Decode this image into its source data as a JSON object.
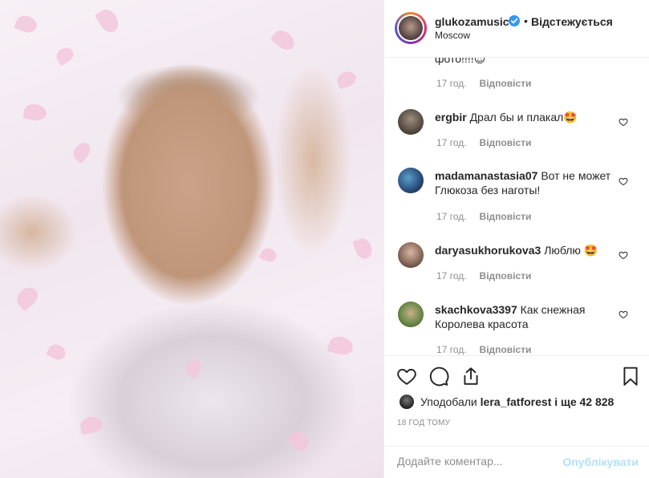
{
  "post": {
    "username": "glukozamusic",
    "follow_status": "Відстежується",
    "location": "Moscow",
    "separator": "•"
  },
  "comments": [
    {
      "username": "",
      "text": "фото!!!!😍",
      "time": "17 год.",
      "reply": "Відповісти"
    },
    {
      "username": "ergbir",
      "text": "Драл бы и плакал🤩",
      "time": "17 год.",
      "reply": "Відповісти"
    },
    {
      "username": "madamanastasia07",
      "text": "Вот не может Глюкоза без наготы!",
      "time": "17 год.",
      "reply": "Відповісти"
    },
    {
      "username": "daryasukhorukova3",
      "text": "Люблю 🤩",
      "time": "17 год.",
      "reply": "Відповісти"
    },
    {
      "username": "skachkova3397",
      "text": "Как снежная Королева красота",
      "time": "17 год.",
      "reply": "Відповісти"
    }
  ],
  "likes": {
    "prefix": "Уподобали",
    "user": "lera_fatforest",
    "suffix": "і ще 42 828"
  },
  "timestamp": "18 ГОД ТОМУ",
  "add_comment": {
    "placeholder": "Додайте коментар...",
    "post_label": "Опублікувати"
  },
  "colors": {
    "verified": "#3897f0",
    "post_button_disabled": "#b2dffc",
    "muted_text": "#8e8e8e"
  },
  "icons": [
    "verified-badge-icon",
    "heart-icon",
    "comment-icon",
    "share-icon",
    "bookmark-icon"
  ]
}
